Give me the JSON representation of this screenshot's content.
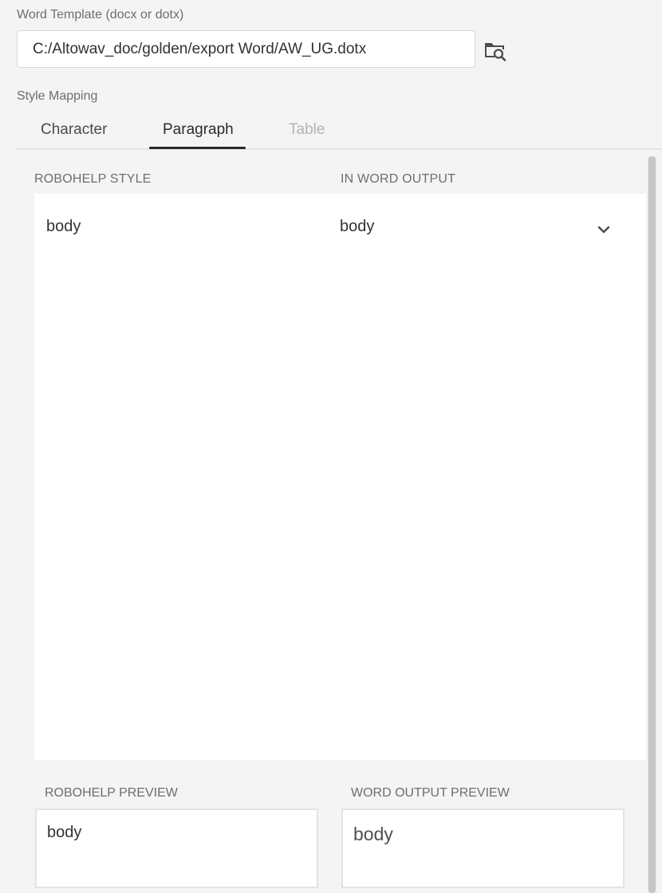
{
  "template": {
    "label": "Word Template (docx or dotx)",
    "path_value": "C:/Altowav_doc/golden/export Word/AW_UG.dotx",
    "browse_icon": "folder-search-icon"
  },
  "style_mapping": {
    "label": "Style Mapping",
    "tabs": [
      {
        "label": "Character",
        "state": "inactive"
      },
      {
        "label": "Paragraph",
        "state": "active"
      },
      {
        "label": "Table",
        "state": "disabled"
      }
    ],
    "columns": {
      "robohelp": "ROBOHELP STYLE",
      "word": "IN WORD OUTPUT"
    },
    "rows": [
      {
        "robohelp_style": "body",
        "word_style": "body"
      }
    ]
  },
  "preview": {
    "robohelp_label": "ROBOHELP PREVIEW",
    "robohelp_text": "body",
    "word_label": "WORD OUTPUT PREVIEW",
    "word_text": "body"
  },
  "colors": {
    "background": "#f4f4f4",
    "panel": "#ffffff",
    "active_tab_indicator": "#2c2c2c",
    "disabled_text": "#b3b3b3"
  }
}
